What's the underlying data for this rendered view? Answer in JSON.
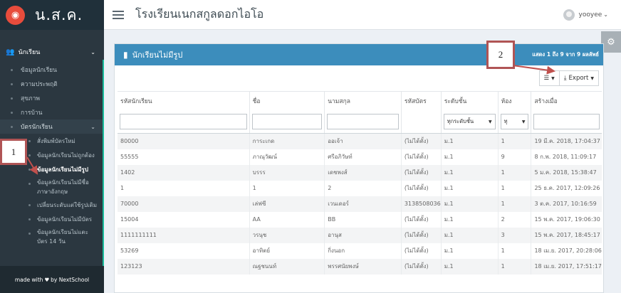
{
  "brand": {
    "logo_icon": "owl-logo-icon",
    "name": "น.ส.ค."
  },
  "topbar": {
    "title": "โรงเรียนเนกสกูลดอกไอโอ",
    "user": "yooyee",
    "user_caret": "⌄"
  },
  "sidebar": {
    "section_label": "นักเรียน",
    "items": [
      {
        "label": "ข้อมูลนักเรียน"
      },
      {
        "label": "ความประพฤติ"
      },
      {
        "label": "สุขภาพ"
      },
      {
        "label": "การบ้าน"
      }
    ],
    "group_label": "บัตรนักเรียน",
    "sub_items": [
      {
        "label": "สั่งพิมพ์บัตรใหม่",
        "active": false
      },
      {
        "label": "ข้อมูลนักเรียนไม่ถูกต้อง",
        "active": false
      },
      {
        "label": "ข้อมูลนักเรียนไม่มีรูป",
        "active": true
      },
      {
        "label": "ข้อมูลนักเรียนไม่มีชื่อภาษาอังกฤษ",
        "active": false
      },
      {
        "label": "เปลี่ยนระดับแต่ใช้รูปเดิม",
        "active": false
      },
      {
        "label": "ข้อมูลนักเรียนไม่มีบัตร",
        "active": false
      },
      {
        "label": "ข้อมูลนักเรียนไม่แตะบัตร 14 วัน",
        "active": false
      }
    ],
    "footer": {
      "made_with": "made with",
      "by": "by NextSchool"
    }
  },
  "panel": {
    "title": "นักเรียนไม่มีรูป",
    "paging": "แสดง 1 ถึง 9 จาก 9 ผลลัพธ์",
    "export_label": "Export",
    "columns": [
      "รหัสนักเรียน",
      "ชื่อ",
      "นามสกุล",
      "รหัสบัตร",
      "ระดับชั้น",
      "ห้อง",
      "สร้างเมื่อ"
    ],
    "filters": {
      "level": "ทุกระดับชั้น",
      "room": "ทุ"
    },
    "rows": [
      [
        "80000",
        "การะเกด",
        "ออเจ้า",
        "(ไม่ได้ตั้ง)",
        "ม.1",
        "1",
        "19 มี.ค. 2018, 17:04:37"
      ],
      [
        "55555",
        "ภาณุวัฒน์",
        "ศรีอภิวัษท์",
        "(ไม่ได้ตั้ง)",
        "ม.1",
        "9",
        "8 ก.พ. 2018, 11:09:17"
      ],
      [
        "1402",
        "บรรร",
        "เดชพงส์",
        "(ไม่ได้ตั้ง)",
        "ม.1",
        "1",
        "5 ม.ค. 2018, 15:38:47"
      ],
      [
        "1",
        "1",
        "2",
        "(ไม่ได้ตั้ง)",
        "ม.1",
        "1",
        "25 ธ.ค. 2017, 12:09:26"
      ],
      [
        "70000",
        "เล่ฟซี",
        "เวนเดอร์",
        "3138508036",
        "ม.1",
        "1",
        "3 ต.ค. 2017, 10:16:59"
      ],
      [
        "15004",
        "AA",
        "BB",
        "(ไม่ได้ตั้ง)",
        "ม.1",
        "2",
        "15 พ.ค. 2017, 19:06:30"
      ],
      [
        "1111111111",
        "วรนุช",
        "อานุส",
        "(ไม่ได้ตั้ง)",
        "ม.1",
        "3",
        "15 พ.ค. 2017, 18:45:17"
      ],
      [
        "53269",
        "อาทิตย์",
        "กิ่งนอก",
        "(ไม่ได้ตั้ง)",
        "ม.1",
        "1",
        "18 เม.ย. 2017, 20:28:06"
      ],
      [
        "123123",
        "ณฐชนนท์",
        "พรรศนัยพงษ์",
        "(ไม่ได้ตั้ง)",
        "ม.1",
        "1",
        "18 เม.ย. 2017, 17:51:17"
      ]
    ]
  },
  "callouts": {
    "one": "1",
    "two": "2"
  },
  "colors": {
    "sidebar": "#2b3740",
    "panel_header": "#3c8dbc",
    "callout_border": "#b05455"
  }
}
